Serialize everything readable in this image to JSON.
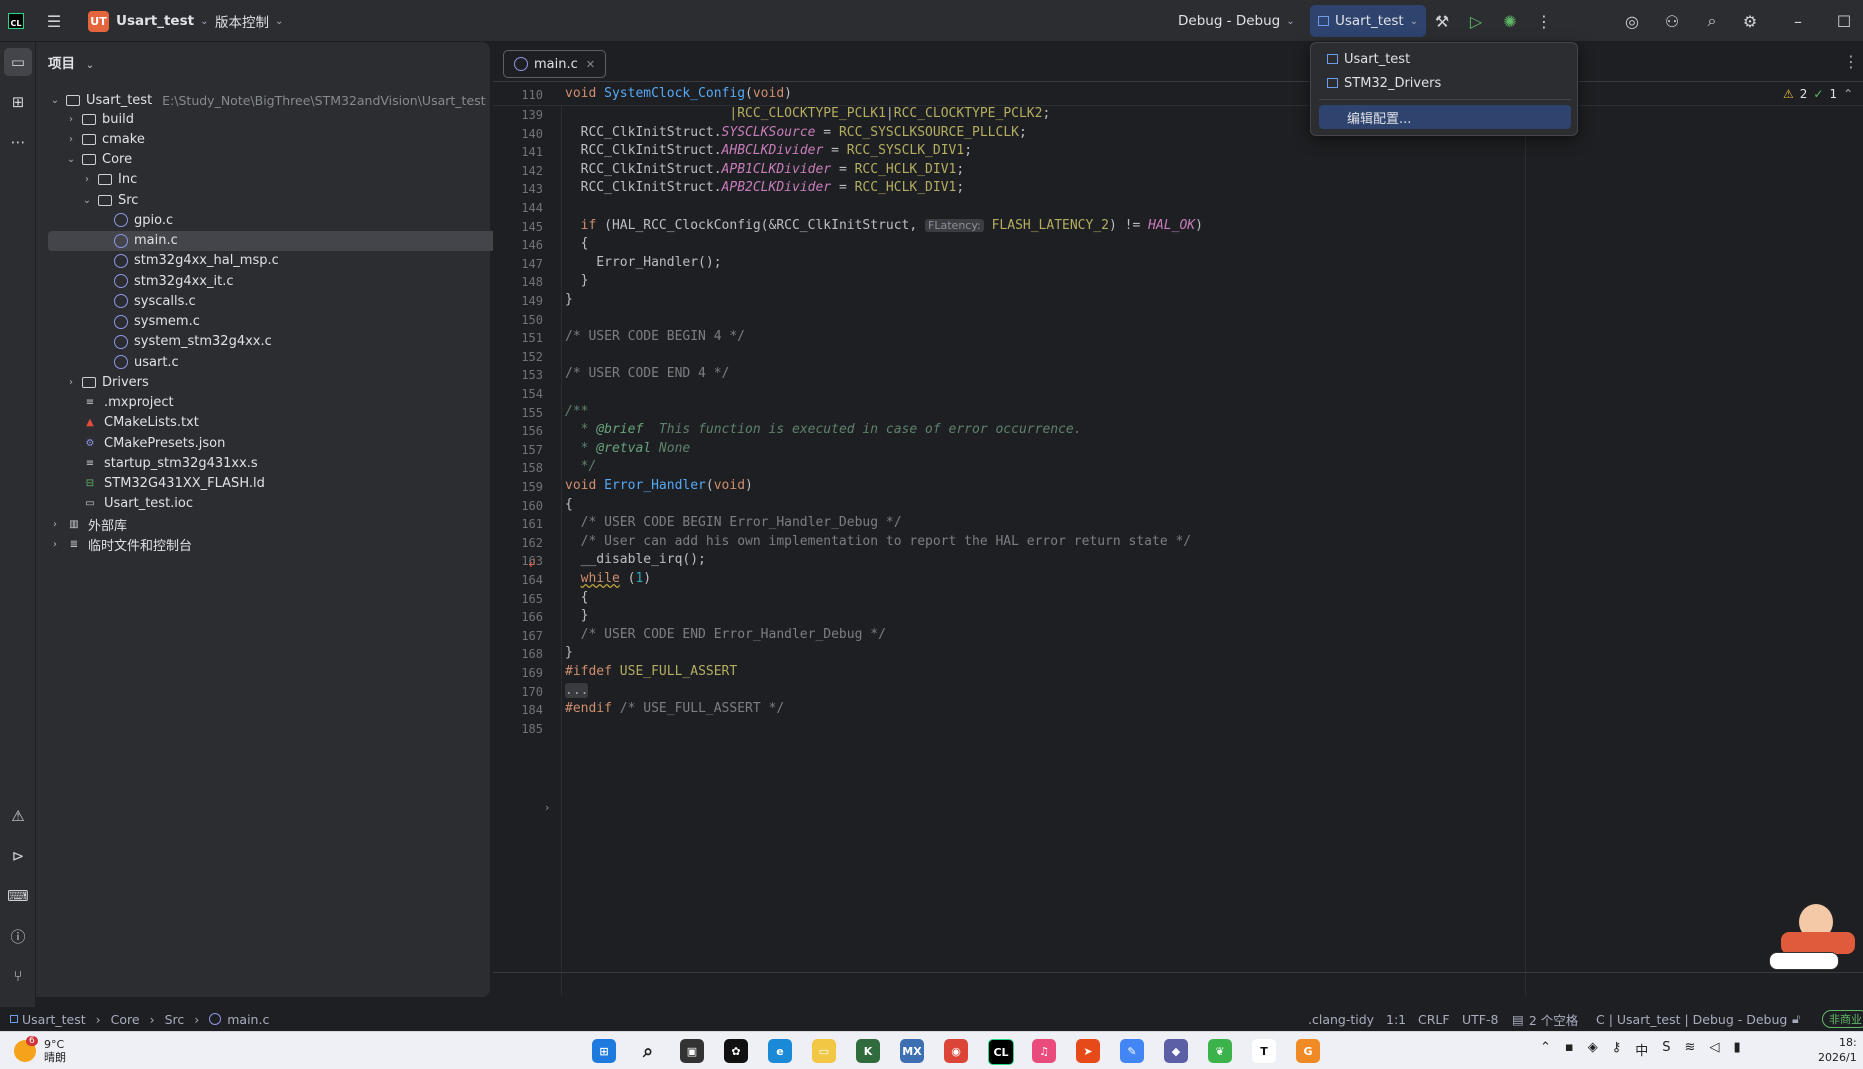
{
  "titlebar": {
    "project_badge": "UT",
    "project_name": "Usart_test",
    "vcs": "版本控制",
    "build_config": "Debug - Debug",
    "run_target": "Usart_test"
  },
  "project_panel": {
    "title": "项目",
    "root": "Usart_test",
    "root_path": "E:\\Study_Note\\BigThree\\STM32andVision\\Usart_test",
    "rows": [
      {
        "label": "build",
        "depth": 1,
        "kind": "folder",
        "arrow": "›"
      },
      {
        "label": "cmake",
        "depth": 1,
        "kind": "folder",
        "arrow": "›"
      },
      {
        "label": "Core",
        "depth": 1,
        "kind": "folder",
        "arrow": "⌄"
      },
      {
        "label": "Inc",
        "depth": 2,
        "kind": "folder",
        "arrow": "›"
      },
      {
        "label": "Src",
        "depth": 2,
        "kind": "folder",
        "arrow": "⌄"
      },
      {
        "label": "gpio.c",
        "depth": 3,
        "kind": "c"
      },
      {
        "label": "main.c",
        "depth": 3,
        "kind": "c",
        "selected": true
      },
      {
        "label": "stm32g4xx_hal_msp.c",
        "depth": 3,
        "kind": "c"
      },
      {
        "label": "stm32g4xx_it.c",
        "depth": 3,
        "kind": "c"
      },
      {
        "label": "syscalls.c",
        "depth": 3,
        "kind": "c"
      },
      {
        "label": "sysmem.c",
        "depth": 3,
        "kind": "c"
      },
      {
        "label": "system_stm32g4xx.c",
        "depth": 3,
        "kind": "c"
      },
      {
        "label": "usart.c",
        "depth": 3,
        "kind": "c"
      },
      {
        "label": "Drivers",
        "depth": 1,
        "kind": "folder",
        "arrow": "›"
      },
      {
        "label": ".mxproject",
        "depth": 1,
        "kind": "text"
      },
      {
        "label": "CMakeLists.txt",
        "depth": 1,
        "kind": "cmake"
      },
      {
        "label": "CMakePresets.json",
        "depth": 1,
        "kind": "json"
      },
      {
        "label": "startup_stm32g431xx.s",
        "depth": 1,
        "kind": "text"
      },
      {
        "label": "STM32G431XX_FLASH.ld",
        "depth": 1,
        "kind": "ld"
      },
      {
        "label": "Usart_test.ioc",
        "depth": 1,
        "kind": "ioc"
      },
      {
        "label": "外部库",
        "depth": 0,
        "kind": "lib",
        "arrow": "›"
      },
      {
        "label": "临时文件和控制台",
        "depth": 0,
        "kind": "scratch",
        "arrow": "›"
      }
    ]
  },
  "editor": {
    "tab_label": "main.c",
    "sticky_line": "110",
    "sticky_code": "void SystemClock_Config(void)",
    "inspections": {
      "warnings": "2",
      "ok": "1"
    },
    "inlay_hint": "FLatency:",
    "lines": [
      {
        "n": "139",
        "html": "                     <span class='mac'>|RCC_CLOCKTYPE_PCLK1</span>|<span class='mac'>RCC_CLOCKTYPE_PCLK2</span>;"
      },
      {
        "n": "140",
        "html": "  RCC_ClkInitStruct.<span class='it'>SYSCLKSource</span> = <span class='mac'>RCC_SYSCLKSOURCE_PLLCLK</span>;"
      },
      {
        "n": "141",
        "html": "  RCC_ClkInitStruct.<span class='it'>AHBCLKDivider</span> = <span class='mac'>RCC_SYSCLK_DIV1</span>;"
      },
      {
        "n": "142",
        "html": "  RCC_ClkInitStruct.<span class='it'>APB1CLKDivider</span> = <span class='mac'>RCC_HCLK_DIV1</span>;"
      },
      {
        "n": "143",
        "html": "  RCC_ClkInitStruct.<span class='it'>APB2CLKDivider</span> = <span class='mac'>RCC_HCLK_DIV1</span>;"
      },
      {
        "n": "144",
        "html": ""
      },
      {
        "n": "145",
        "html": "  <span class='kw'>if</span> (HAL_RCC_ClockConfig(&amp;RCC_ClkInitStruct, <span class='hint' data-name='inlay-hint' data-bind='editor.inlay_hint'></span> <span class='mac'>FLASH_LATENCY_2</span>) != <span class='it'>HAL_OK</span>)"
      },
      {
        "n": "146",
        "html": "  {"
      },
      {
        "n": "147",
        "html": "    Error_Handler();"
      },
      {
        "n": "148",
        "html": "  }"
      },
      {
        "n": "149",
        "html": "}"
      },
      {
        "n": "150",
        "html": ""
      },
      {
        "n": "151",
        "html": "<span class='cm'>/* USER CODE BEGIN 4 */</span>"
      },
      {
        "n": "152",
        "html": ""
      },
      {
        "n": "153",
        "html": "<span class='cm'>/* USER CODE END 4 */</span>"
      },
      {
        "n": "154",
        "html": ""
      },
      {
        "n": "155",
        "html": "<span class='doc'>/**</span>"
      },
      {
        "n": "156",
        "html": "<span class='doc'>  * </span><span class='tag'>@brief</span><span class='doc'>  This function is executed in case of error occurrence.</span>"
      },
      {
        "n": "157",
        "html": "<span class='doc'>  * </span><span class='tag'>@retval</span><span class='doc'> None</span>"
      },
      {
        "n": "158",
        "html": "<span class='doc'>  */</span>"
      },
      {
        "n": "159",
        "html": "<span class='kw'>void</span> <span class='fn'>Error_Handler</span>(<span class='kw'>void</span>)"
      },
      {
        "n": "160",
        "html": "{"
      },
      {
        "n": "161",
        "html": "  <span class='cm'>/* USER CODE BEGIN Error_Handler_Debug */</span>"
      },
      {
        "n": "162",
        "html": "  <span class='cm'>/* User can add his own implementation to report the HAL error return state */</span>"
      },
      {
        "n": "163",
        "html": "  __disable_irq();"
      },
      {
        "n": "164",
        "html": "  <span class='kw' style='text-decoration:underline wavy #b8a23b;'>while</span> (<span class='num'>1</span>)"
      },
      {
        "n": "165",
        "html": "  {"
      },
      {
        "n": "166",
        "html": "  }"
      },
      {
        "n": "167",
        "html": "  <span class='cm'>/* USER CODE END Error_Handler_Debug */</span>"
      },
      {
        "n": "168",
        "html": "}"
      },
      {
        "n": "169",
        "html": "<span class='kw'>#ifdef</span> <span class='mac'>USE_FULL_ASSERT</span>"
      },
      {
        "n": "170",
        "html": "<span class='fold'>...</span>"
      },
      {
        "n": "184",
        "html": "<span class='kw'>#endif</span> <span class='cm'>/* USE_FULL_ASSERT */</span>"
      },
      {
        "n": "185",
        "html": ""
      }
    ]
  },
  "run_popup": {
    "items": [
      "Usart_test",
      "STM32_Drivers"
    ],
    "edit": "编辑配置..."
  },
  "statusbar": {
    "crumbs": [
      "Usart_test",
      "Core",
      "Src",
      "main.c"
    ],
    "linter": ".clang-tidy",
    "position": "1:1",
    "line_sep": "CRLF",
    "encoding": "UTF-8",
    "indent": "2 个空格",
    "context": "C | Usart_test | Debug - Debug",
    "license": "非商业"
  },
  "taskbar": {
    "weather_temp": "9°C",
    "weather_desc": "晴朗",
    "weather_badge": "6",
    "time": "18:",
    "date": "2026/1"
  },
  "colors": {
    "accent": "#2e436e",
    "bg": "#1e1f22",
    "panel": "#2b2d30"
  }
}
